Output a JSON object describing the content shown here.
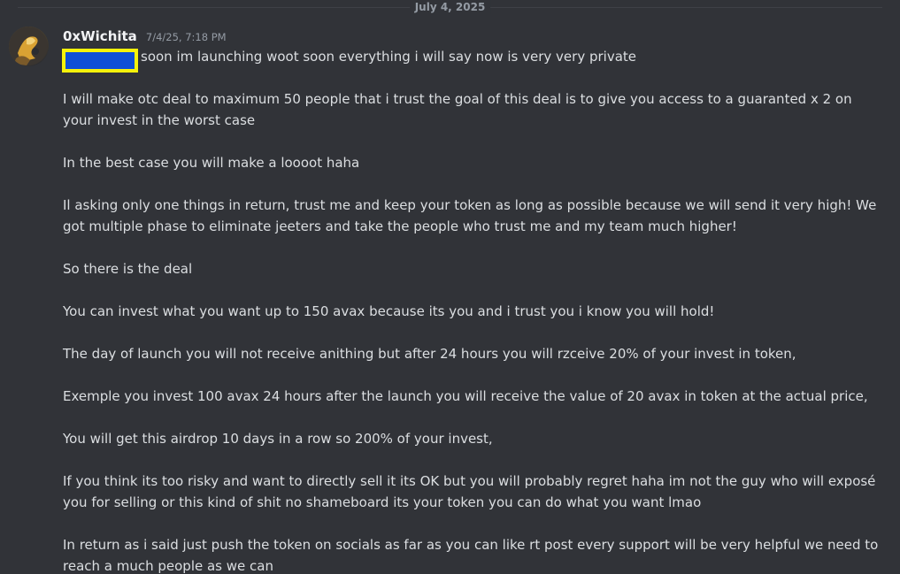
{
  "date_divider": "July 4, 2025",
  "message": {
    "author": "0xWichita",
    "timestamp": "7/4/25, 7:18 PM",
    "redaction_color": "#0f4fd6",
    "redaction_border_color": "#f6f20a",
    "paragraphs": [
      "soon im launching woot soon everything i will say now is very very private",
      "I will make otc deal to maximum 50 people that i trust the goal of this deal is to give you access to a guaranted x 2 on your invest in the worst case",
      "In the best case you will make a loooot haha",
      "Il asking only one things in return, trust me and keep your token as long as possible because we will send it very high! We got multiple phase to eliminate jeeters and take the people who trust me and my team much higher!",
      "So there is the deal",
      "You can invest what you want up to 150 avax because its you and i trust you i know you will hold!",
      "The day of launch you will not receive anithing but after 24 hours you will rzceive 20% of your invest in token,",
      "Exemple you invest 100 avax 24 hours after the launch you will receive the value of 20 avax in token at the actual price,",
      "You will get this airdrop 10 days in a row so 200% of your invest,",
      "If you think its too risky and want to directly sell it its OK but you will probably regret haha im not the guy who will exposé you for selling or this kind of shit no shameboard its your token you can do what you want lmao",
      "In return as i said just push the token on socials as far as you can like rt post every support will be very helpful we need to reach a much people as we can"
    ]
  }
}
